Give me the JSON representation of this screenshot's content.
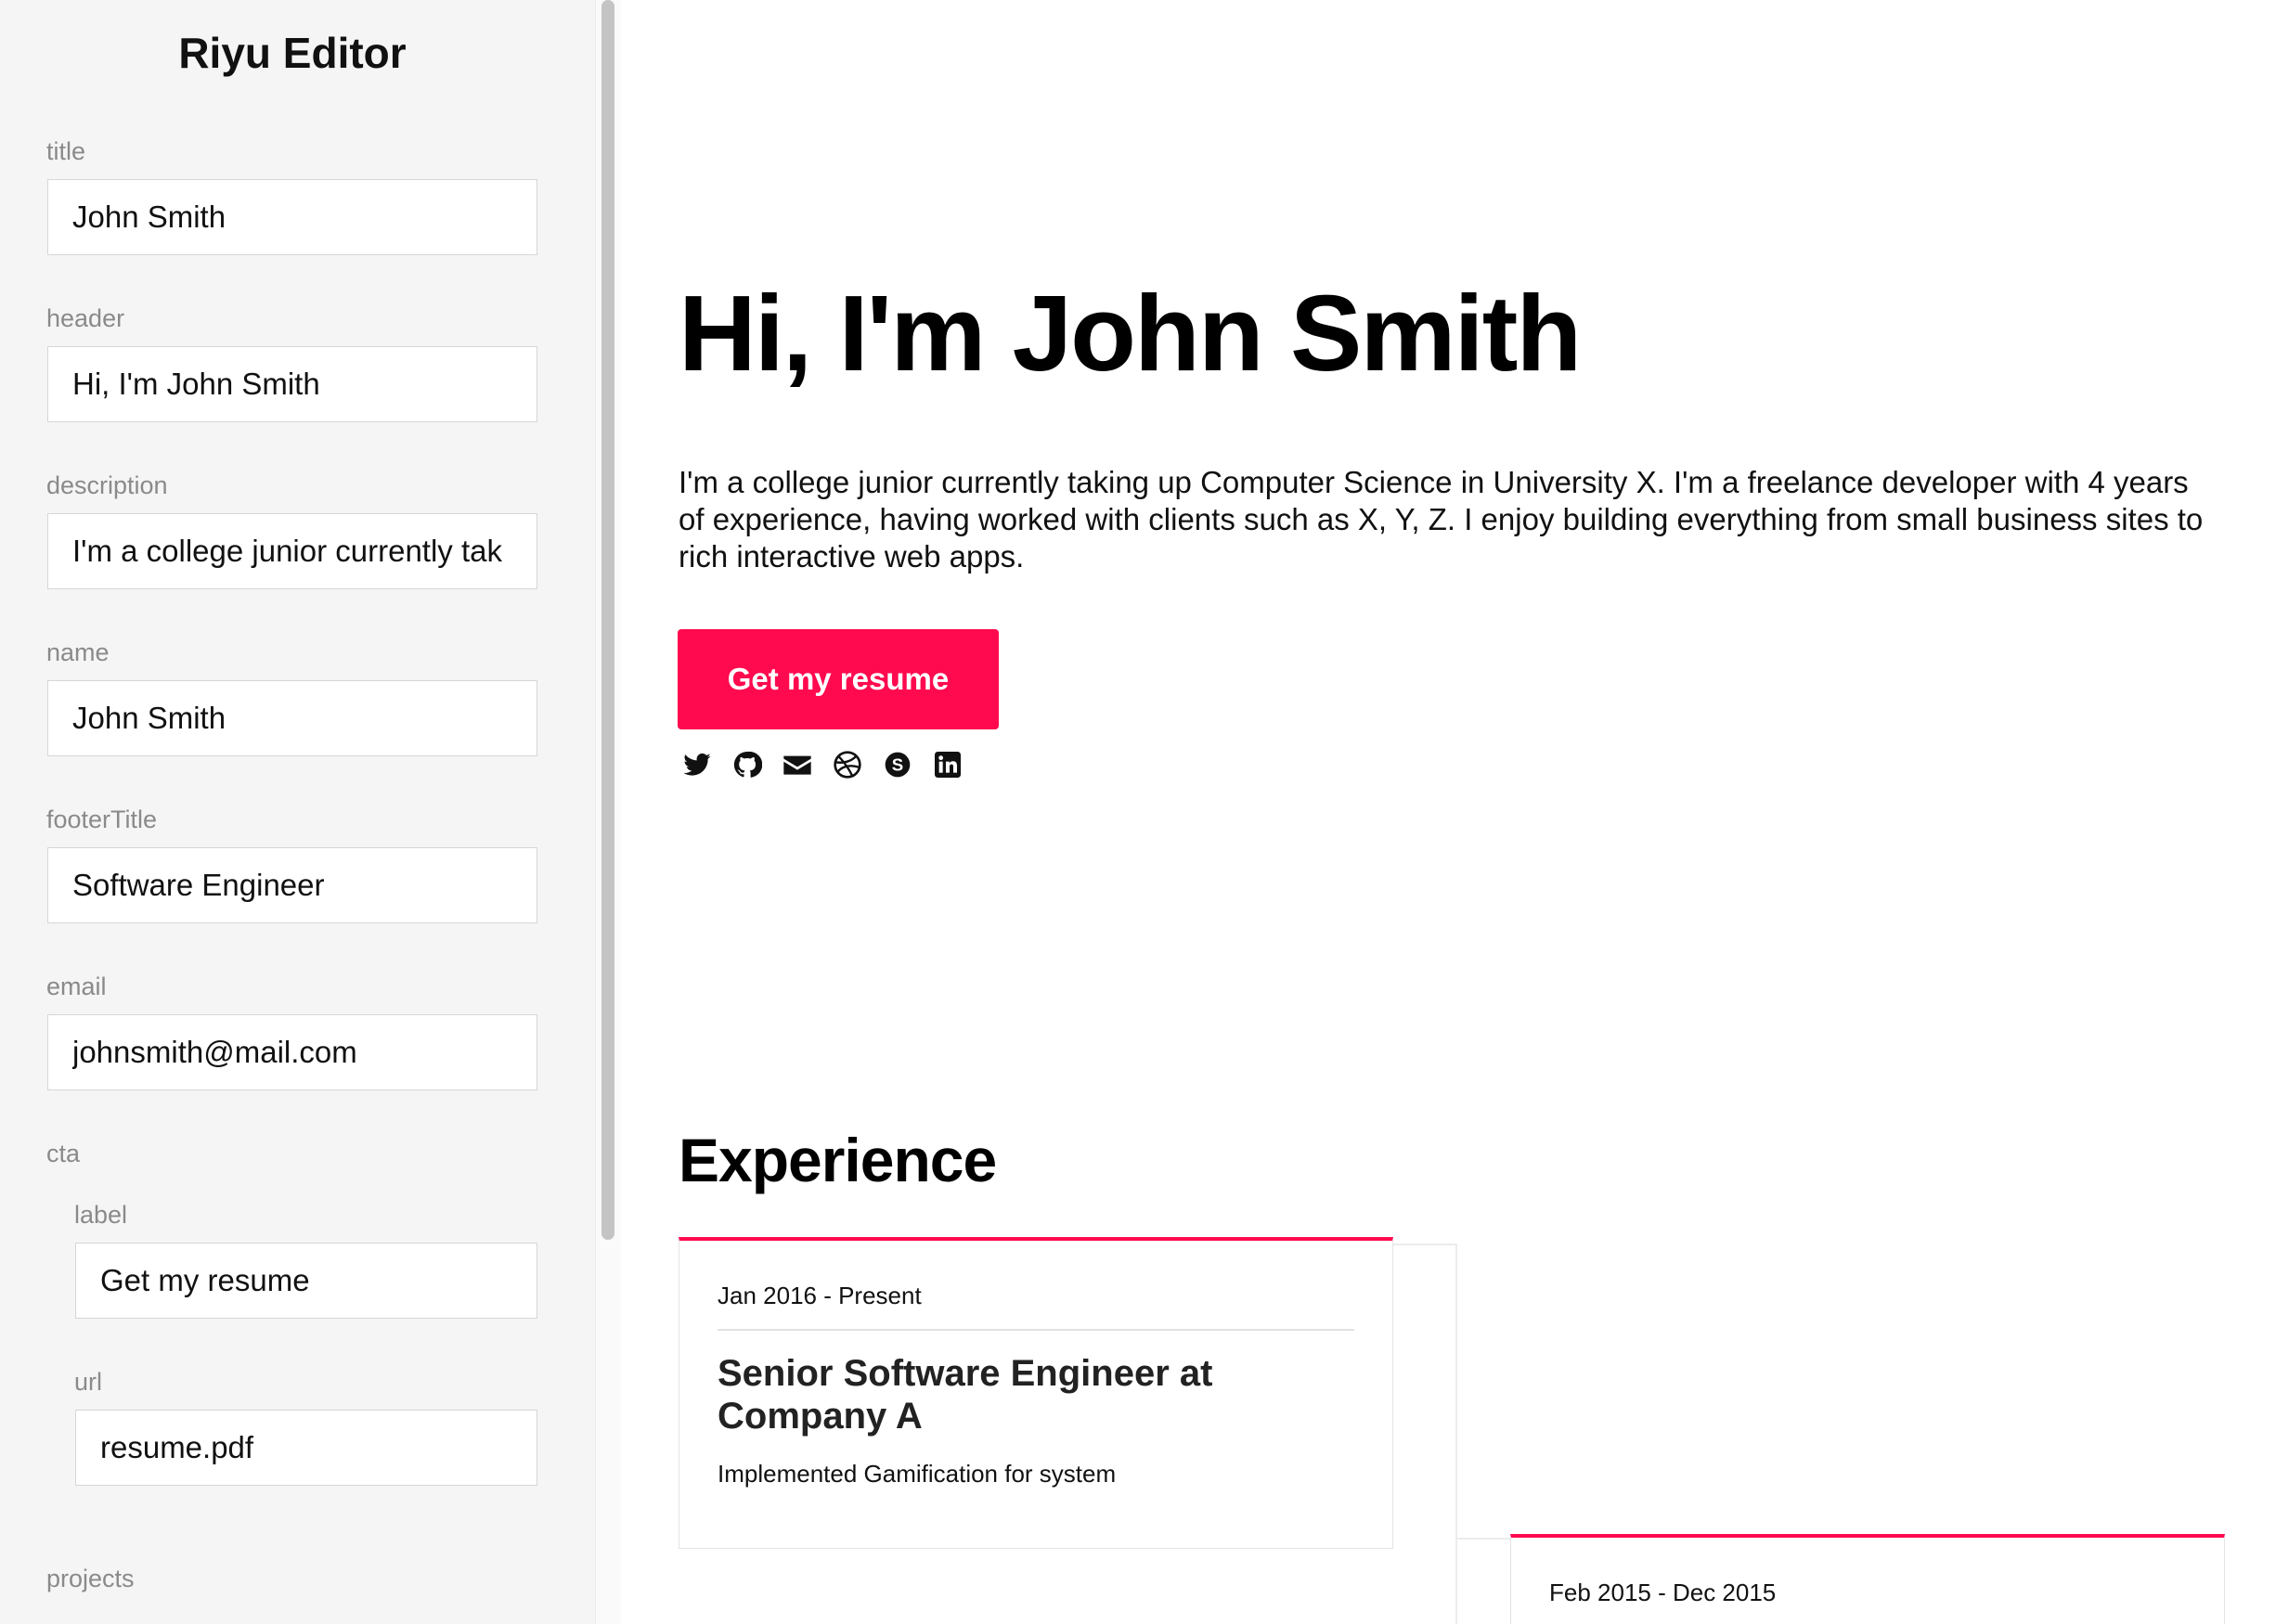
{
  "sidebar": {
    "title": "Riyu Editor",
    "fields": {
      "title": {
        "label": "title",
        "value": "John Smith"
      },
      "header": {
        "label": "header",
        "value": "Hi, I'm John Smith"
      },
      "description": {
        "label": "description",
        "value": "I'm a college junior currently tak"
      },
      "name": {
        "label": "name",
        "value": "John Smith"
      },
      "footerTitle": {
        "label": "footerTitle",
        "value": "Software Engineer"
      },
      "email": {
        "label": "email",
        "value": "johnsmith@mail.com"
      },
      "cta": {
        "label": "cta",
        "label_field": {
          "label": "label",
          "value": "Get my resume"
        },
        "url_field": {
          "label": "url",
          "value": "resume.pdf"
        }
      },
      "projects": {
        "label": "projects"
      }
    }
  },
  "preview": {
    "header": "Hi, I'm John Smith",
    "description": "I'm a college junior currently taking up Computer Science in University X. I'm a freelance developer with 4 years of experience, having worked with clients such as X, Y, Z. I enjoy building everything from small business sites to rich interactive web apps.",
    "cta_label": "Get my resume",
    "social_icons": [
      "twitter-icon",
      "github-icon",
      "email-icon",
      "dribbble-icon",
      "skype-icon",
      "linkedin-icon"
    ],
    "experience": {
      "title": "Experience",
      "items": [
        {
          "date": "Jan 2016 - Present",
          "title": "Senior Software Engineer at Company A",
          "description": "Implemented Gamification for system"
        },
        {
          "date": "Feb 2015 - Dec 2015"
        }
      ]
    }
  },
  "colors": {
    "accent": "#ff0a4f",
    "sidebar_bg": "#f5f5f5",
    "label": "#8a8a8a"
  }
}
